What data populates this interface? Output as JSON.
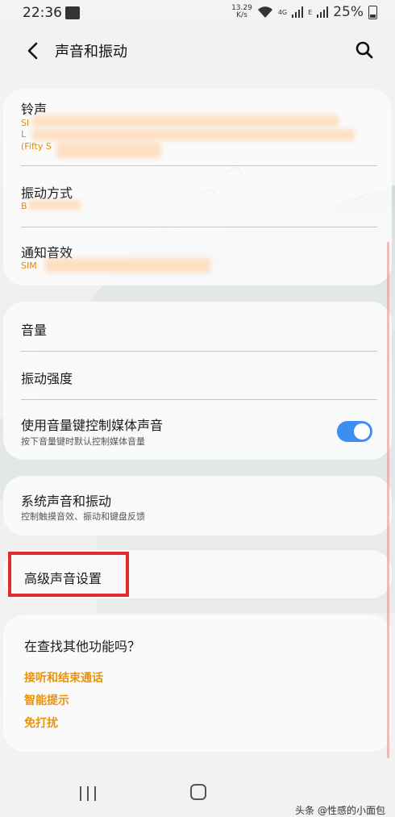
{
  "status_bar": {
    "time": "22:36",
    "net_speed_value": "13.29",
    "net_speed_unit": "K/s",
    "signal_1": "4G",
    "signal_2": "E",
    "battery": "25%"
  },
  "app_bar": {
    "title": "声音和振动",
    "back_icon": "chevron-left-icon",
    "search_icon": "search-icon"
  },
  "card_sounds": {
    "ringtone": {
      "title": "铃声",
      "value_line1": "SI",
      "value_line2": "L",
      "value_line3": "(Fifty S"
    },
    "vibration_pattern": {
      "title": "振动方式",
      "value": "B"
    },
    "notification_sound": {
      "title": "通知音效",
      "value": "SIM"
    }
  },
  "card_volume": {
    "volume": {
      "title": "音量"
    },
    "vibration_intensity": {
      "title": "振动强度"
    },
    "media_volume_keys": {
      "title": "使用音量键控制媒体声音",
      "subtitle": "按下音量键时默认控制媒体音量",
      "enabled": true
    }
  },
  "card_system": {
    "system_sound": {
      "title": "系统声音和振动",
      "subtitle": "控制触摸音效、振动和键盘反馈"
    }
  },
  "card_advanced": {
    "advanced": {
      "title": "高级声音设置"
    }
  },
  "card_suggestions": {
    "heading": "在查找其他功能吗？",
    "links": [
      "接听和结束通话",
      "智能提示",
      "免打扰"
    ]
  },
  "nav_bar": {
    "recent_icon": "recent-apps-icon",
    "home_icon": "home-icon"
  },
  "watermark": "头条 @性感的小面包",
  "colors": {
    "accent": "#3e8df2",
    "link": "#e9920c",
    "highlight": "#e02c2c"
  }
}
